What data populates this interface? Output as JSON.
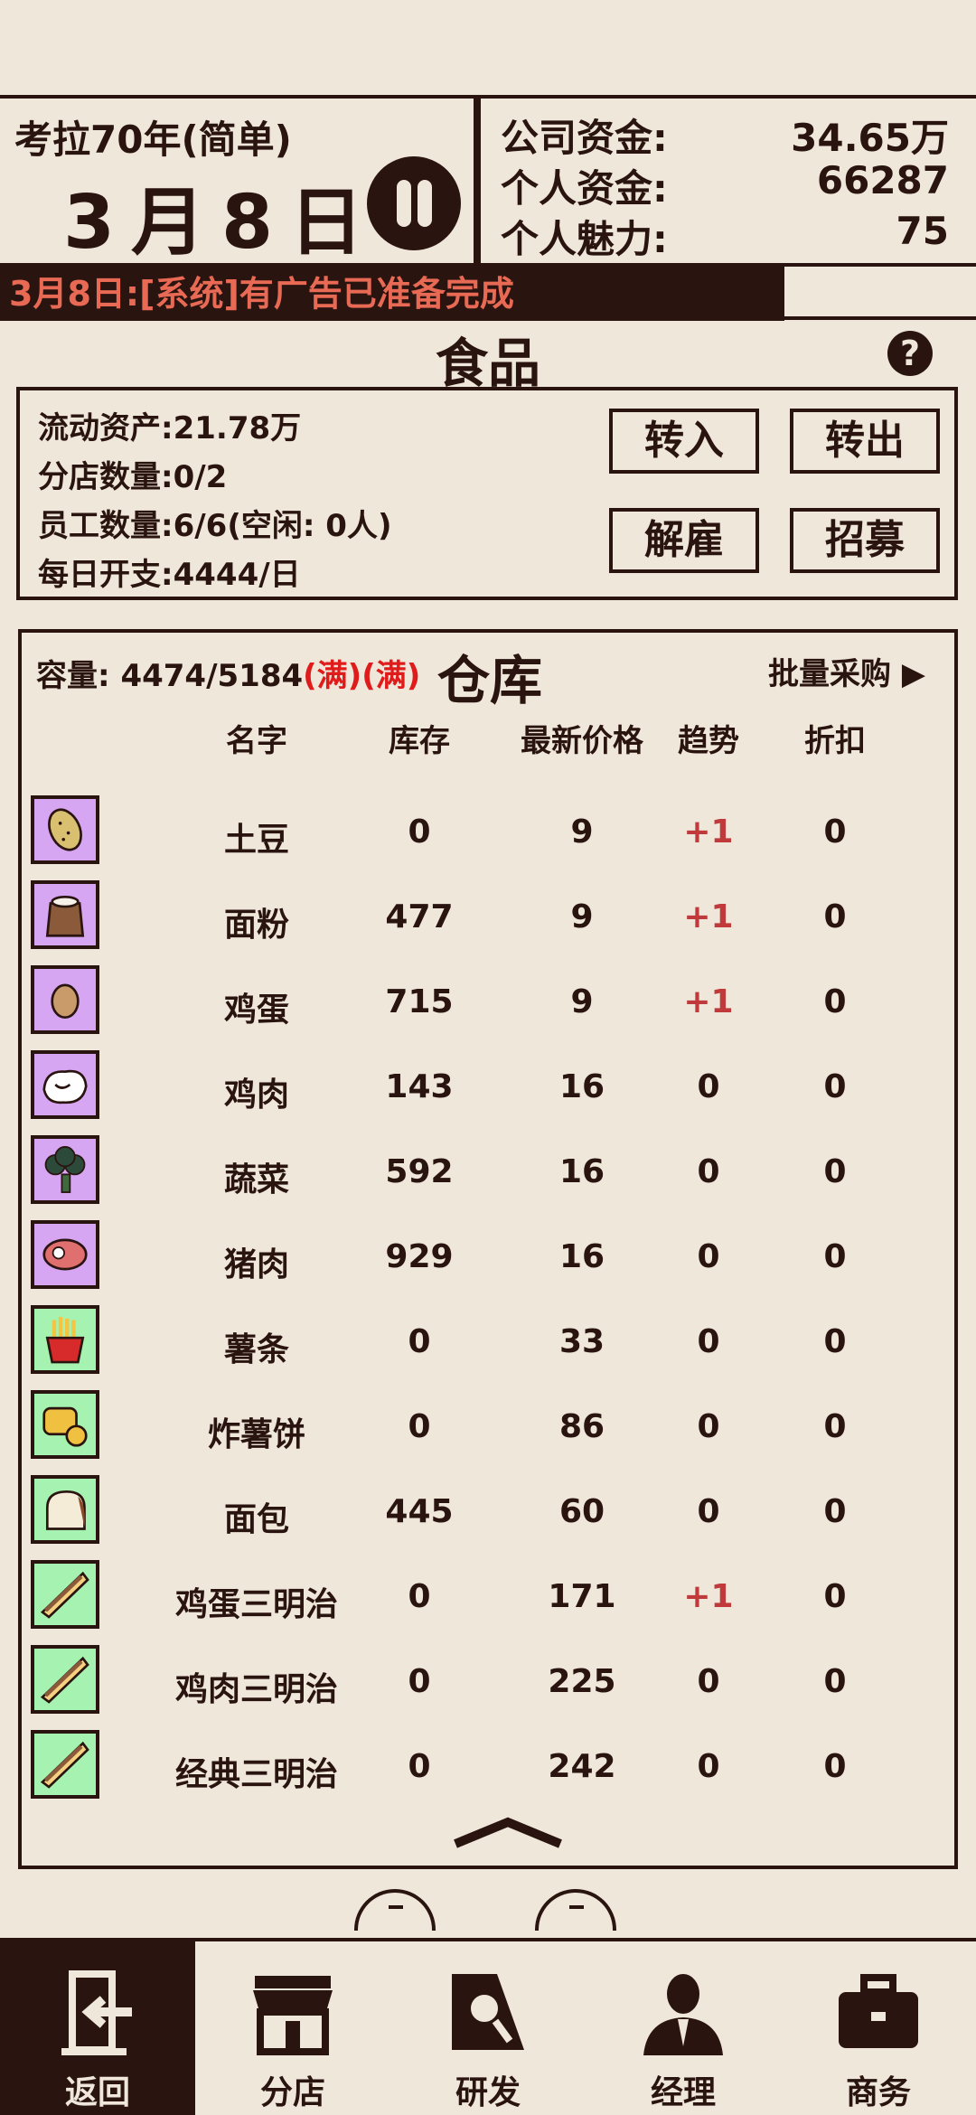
{
  "header": {
    "difficulty": "考拉70年(简单)",
    "date": "3月8日",
    "company_funds_label": "公司资金:",
    "company_funds": "34.65万",
    "personal_funds_label": "个人资金:",
    "personal_funds": "66287",
    "charm_label": "个人魅力:",
    "charm": "75"
  },
  "news": "3月8日:[系统]有广告已准备完成",
  "section_title": "食品",
  "info": {
    "assets": "流动资产:21.78万",
    "branches": "分店数量:0/2",
    "staff": "员工数量:6/6(空闲: 0人)",
    "daily_cost": "每日开支:4444/日",
    "btn_transfer_in": "转入",
    "btn_transfer_out": "转出",
    "btn_fire": "解雇",
    "btn_recruit": "招募"
  },
  "warehouse": {
    "capacity_label": "容量:",
    "capacity": "4474/5184",
    "full1": "(满)",
    "full2": "(满)",
    "title": "仓库",
    "bulk_buy": "批量采购 ▶",
    "columns": [
      "名字",
      "库存",
      "最新价格",
      "趋势",
      "折扣"
    ],
    "items": [
      {
        "name": "土豆",
        "stock": "0",
        "price": "9",
        "trend": "+1",
        "discount": "0",
        "icon": "potato-icon",
        "bg": "#d6a6f2"
      },
      {
        "name": "面粉",
        "stock": "477",
        "price": "9",
        "trend": "+1",
        "discount": "0",
        "icon": "flour-sack-icon",
        "bg": "#d6a6f2"
      },
      {
        "name": "鸡蛋",
        "stock": "715",
        "price": "9",
        "trend": "+1",
        "discount": "0",
        "icon": "egg-icon",
        "bg": "#d6a6f2"
      },
      {
        "name": "鸡肉",
        "stock": "143",
        "price": "16",
        "trend": "0",
        "discount": "0",
        "icon": "chicken-icon",
        "bg": "#d6a6f2"
      },
      {
        "name": "蔬菜",
        "stock": "592",
        "price": "16",
        "trend": "0",
        "discount": "0",
        "icon": "broccoli-icon",
        "bg": "#d6a6f2"
      },
      {
        "name": "猪肉",
        "stock": "929",
        "price": "16",
        "trend": "0",
        "discount": "0",
        "icon": "steak-icon",
        "bg": "#d6a6f2"
      },
      {
        "name": "薯条",
        "stock": "0",
        "price": "33",
        "trend": "0",
        "discount": "0",
        "icon": "fries-icon",
        "bg": "#a6f2b0"
      },
      {
        "name": "炸薯饼",
        "stock": "0",
        "price": "86",
        "trend": "0",
        "discount": "0",
        "icon": "hashbrown-icon",
        "bg": "#a6f2b0"
      },
      {
        "name": "面包",
        "stock": "445",
        "price": "60",
        "trend": "0",
        "discount": "0",
        "icon": "bread-icon",
        "bg": "#a6f2b0"
      },
      {
        "name": "鸡蛋三明治",
        "stock": "0",
        "price": "171",
        "trend": "+1",
        "discount": "0",
        "icon": "sandwich-icon",
        "bg": "#a6f2b0"
      },
      {
        "name": "鸡肉三明治",
        "stock": "0",
        "price": "225",
        "trend": "0",
        "discount": "0",
        "icon": "sandwich-icon",
        "bg": "#a6f2b0"
      },
      {
        "name": "经典三明治",
        "stock": "0",
        "price": "242",
        "trend": "0",
        "discount": "0",
        "icon": "sandwich-icon",
        "bg": "#a6f2b0"
      }
    ]
  },
  "nav": [
    {
      "label": "返回",
      "icon": "exit-door-icon"
    },
    {
      "label": "分店",
      "icon": "shop-icon"
    },
    {
      "label": "研发",
      "icon": "research-icon"
    },
    {
      "label": "经理",
      "icon": "manager-icon"
    },
    {
      "label": "商务",
      "icon": "briefcase-icon"
    }
  ],
  "colors": {
    "dark": "#2a1410",
    "bg": "#efe7da",
    "trend_up": "#c0393b",
    "news": "#e86a55",
    "full": "#e01b1b"
  }
}
